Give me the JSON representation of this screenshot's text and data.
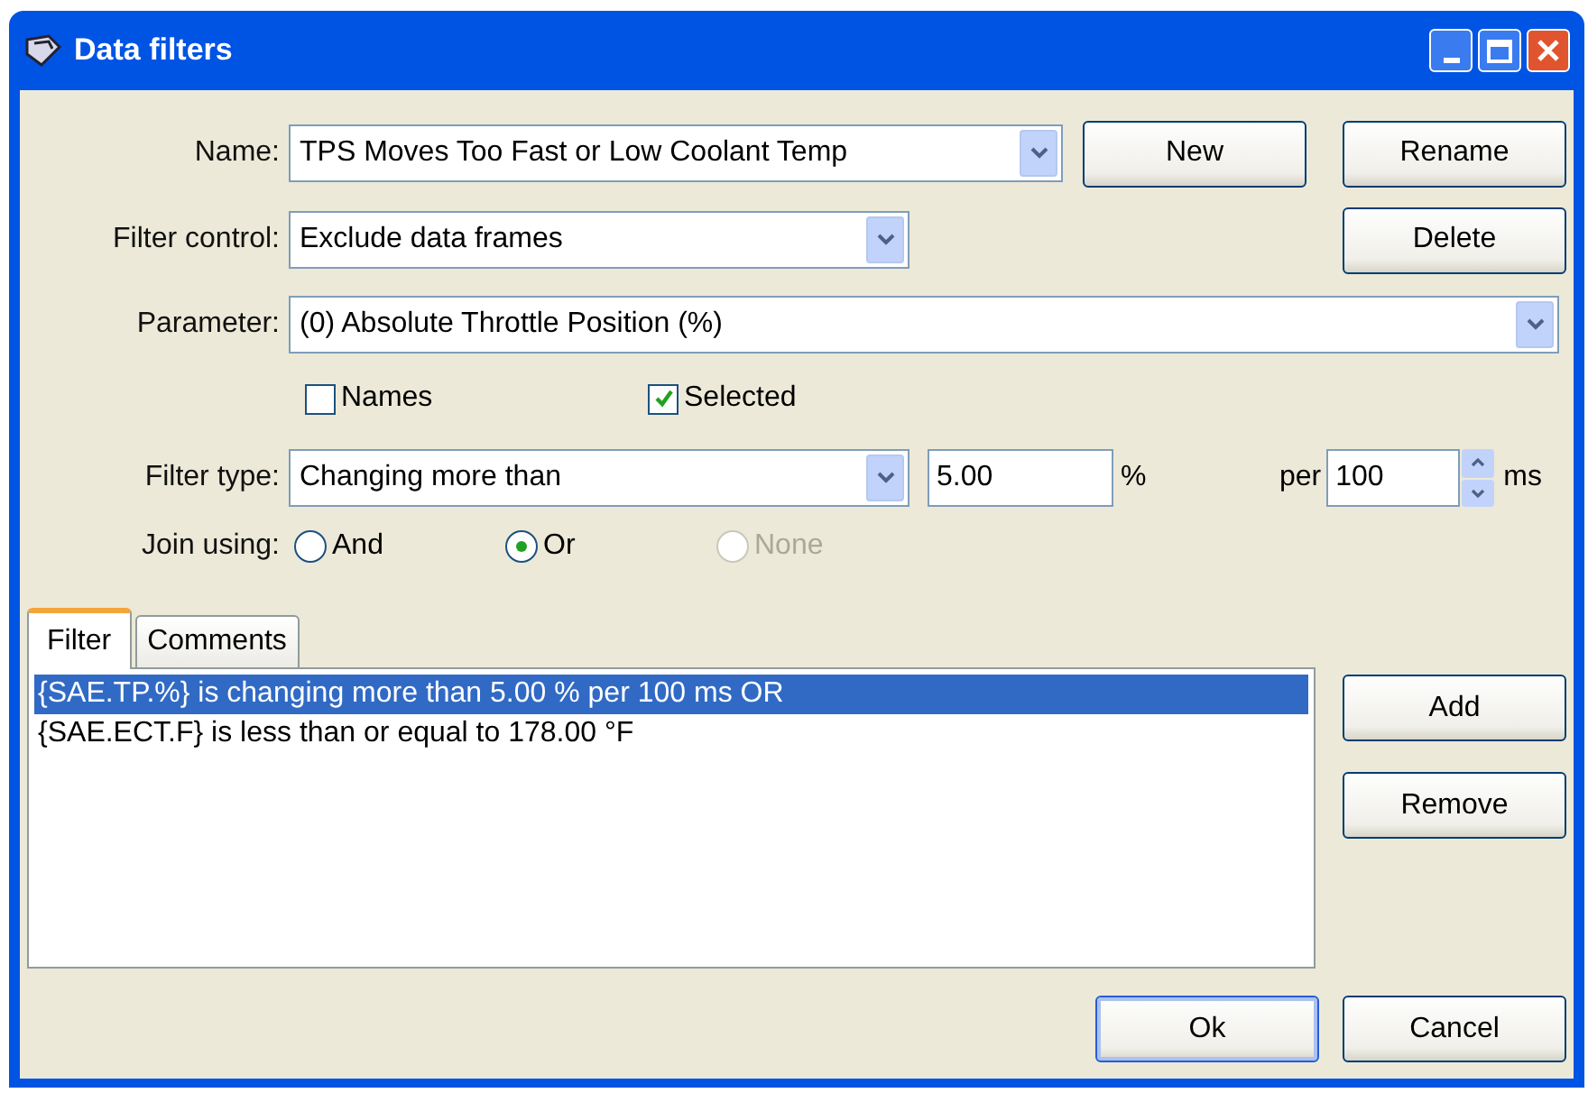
{
  "window": {
    "title": "Data filters"
  },
  "name": {
    "label": "Name:",
    "value": "TPS Moves Too Fast or Low Coolant Temp"
  },
  "name_buttons": [
    {
      "label": "New"
    },
    {
      "label": "Rename"
    }
  ],
  "filter_control": {
    "label": "Filter control:",
    "value": "Exclude data frames"
  },
  "delete_button": {
    "label": "Delete"
  },
  "parameter": {
    "label": "Parameter:",
    "value": "(0) Absolute Throttle Position (%)"
  },
  "checkboxes": [
    {
      "label": "Names",
      "checked": false
    },
    {
      "label": "Selected",
      "checked": true
    }
  ],
  "filter_type": {
    "label": "Filter type:",
    "value": "Changing more than",
    "amount": "5.00",
    "amount_unit": "%",
    "per_label": "per",
    "period": "100",
    "period_unit": "ms"
  },
  "join": {
    "label": "Join using:",
    "options": [
      {
        "label": "And",
        "selected": false,
        "disabled": false
      },
      {
        "label": "Or",
        "selected": true,
        "disabled": false
      },
      {
        "label": "None",
        "selected": false,
        "disabled": true
      }
    ]
  },
  "tabs": [
    {
      "label": "Filter",
      "selected": true
    },
    {
      "label": "Comments",
      "selected": false
    }
  ],
  "filters": [
    {
      "text": "{SAE.TP.%} is changing more than 5.00 % per 100 ms OR",
      "selected": true
    },
    {
      "text": "{SAE.ECT.F} is less than or equal to 178.00 °F",
      "selected": false
    }
  ],
  "side_buttons": [
    {
      "label": "Add"
    },
    {
      "label": "Remove"
    }
  ],
  "buttons": [
    {
      "label": "Ok",
      "default": true
    },
    {
      "label": "Cancel",
      "default": false
    }
  ]
}
